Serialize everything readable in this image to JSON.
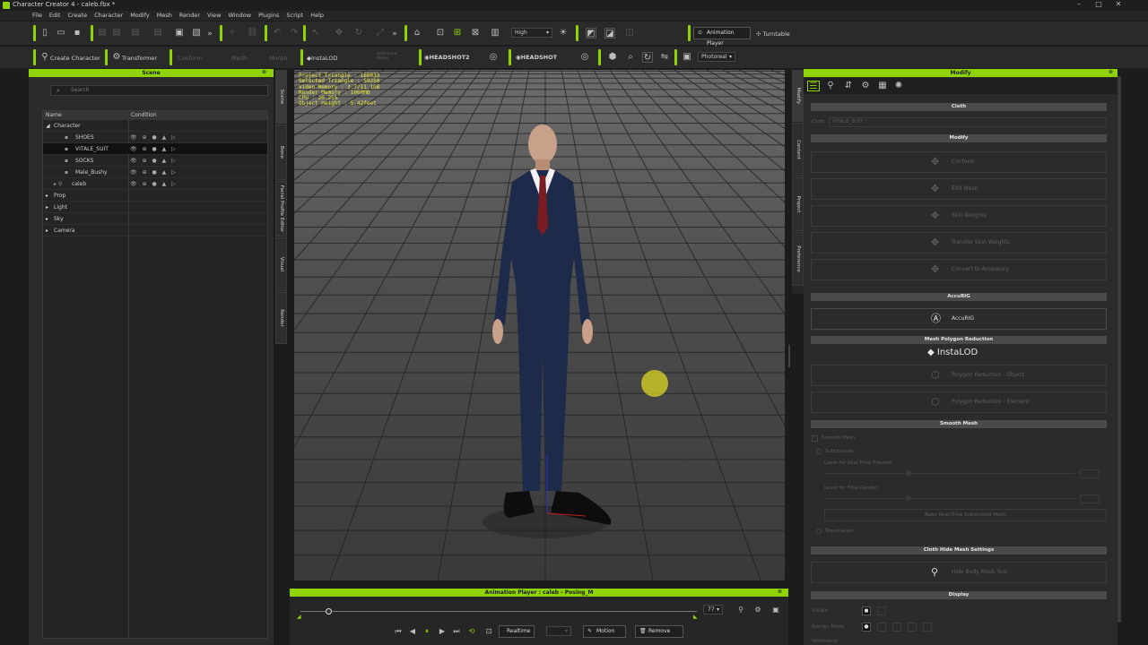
{
  "window": {
    "title": "Character Creator 4 - caleb.fbx *"
  },
  "menu": [
    "File",
    "Edit",
    "Create",
    "Character",
    "Modify",
    "Mesh",
    "Render",
    "View",
    "Window",
    "Plugins",
    "Script",
    "Help"
  ],
  "toolbar1": {
    "quality": "High",
    "animation_player": "Animation Player",
    "turntable": "Turntable"
  },
  "toolbar2": {
    "create_character": "Create Character",
    "transformer": "Transformer",
    "conform": "Conform",
    "mesh": "Mesh",
    "morph": "Morph",
    "reference_model": "Reference Model",
    "instalod": "InstaLOD",
    "headshot2": "HEADSHOT2",
    "headshot": "HEADSHOT",
    "render_mode": "Photoreal"
  },
  "scene": {
    "title": "Scene",
    "search_placeholder": "Search",
    "col_name": "Name",
    "col_condition": "Condition",
    "character": "Character",
    "items": [
      {
        "name": "SHOES",
        "sel": false
      },
      {
        "name": "VITALE_SUIT",
        "sel": true
      },
      {
        "name": "SOCKS",
        "sel": false
      },
      {
        "name": "Male_Bushy",
        "sel": false
      },
      {
        "name": "caleb",
        "sel": false
      }
    ],
    "groups": [
      "Prop",
      "Light",
      "Sky",
      "Camera"
    ]
  },
  "side_tabs_left": [
    "Scene",
    "Bone",
    "Facial Profile Editor",
    "Visual",
    "Render"
  ],
  "side_tabs_right": [
    "Modify",
    "Content",
    "Project",
    "Preference"
  ],
  "viewport": {
    "hud": [
      "Project Triangle : 160033",
      "Selected Triangle : 59250",
      "Video Memory : 3.7/11.1GB",
      "Render Memory : 1060MB",
      "CPU : 20.25%",
      "Object Height : 5.42feet"
    ]
  },
  "anim": {
    "title": "Animation Player : caleb - Posing_M",
    "frame": "77",
    "realtime": "Realtime",
    "motion": "Motion",
    "remove": "Remove",
    "progress": 0.07
  },
  "modify": {
    "title": "Modify",
    "cloth": "Cloth",
    "cloth_name_label": "Cloth",
    "cloth_name_value": "VITALE_SUIT",
    "modify_section": "Modify",
    "modify_buttons": [
      "Conform",
      "Edit Mesh",
      "Skin Weights",
      "Transfer Skin Weights",
      "Convert to Accessory"
    ],
    "accurig": "AccuRIG",
    "accurig_button": "AccuRIG",
    "mesh_reduction": "Mesh Polygon Reduction",
    "instalod": "InstaLOD",
    "poly_buttons": [
      "Polygon Reduction - Object",
      "Polygon Reduction - Element"
    ],
    "smooth_mesh": "Smooth Mesh",
    "smooth_mesh_cb": "Smooth Mesh",
    "subdivision": "Subdivision",
    "level_realtime": "Level for Real-Time Preview",
    "level_render": "Level for Final Render",
    "bake": "Bake Real-Time Subdivided Mesh",
    "tessellation": "Tessellation",
    "cloth_hide": "Cloth Hide Mesh Settings",
    "hide_button": "Hide Body Mesh Tool",
    "display": "Display",
    "visible": "Visible",
    "render_mode": "Render Mode",
    "wireframe": "Wireframe"
  },
  "colors": {
    "accent": "#8fd400",
    "panel": "#2b2b2b"
  }
}
